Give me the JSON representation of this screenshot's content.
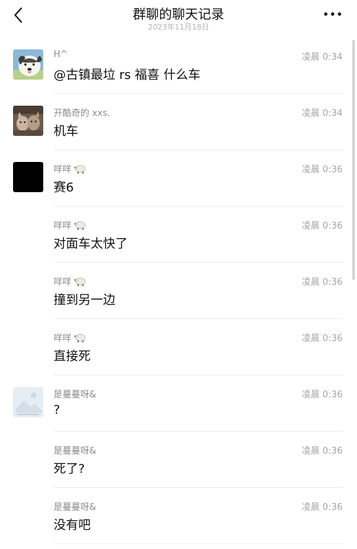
{
  "header": {
    "title": "群聊的聊天记录",
    "date": "2023年11月18日"
  },
  "messages": [
    {
      "sender": "H^",
      "time": "凌晨 0:34",
      "text": "@古镇最垃 rs 福喜 什么车",
      "avatar": "dog-photo-avatar"
    },
    {
      "sender": "开酷奇的 xxs.",
      "time": "凌晨 0:34",
      "text": "机车",
      "avatar": "cat-photo-avatar"
    },
    {
      "sender": "咩咩",
      "time": "凌晨 0:36",
      "text": "赛6",
      "avatar": "black-avatar",
      "emoji": "sheep-icon"
    },
    {
      "sender": "咩咩",
      "time": "凌晨 0:36",
      "text": "对面车太快了",
      "emoji": "sheep-icon"
    },
    {
      "sender": "咩咩",
      "time": "凌晨 0:36",
      "text": "撞到另一边",
      "emoji": "sheep-icon"
    },
    {
      "sender": "咩咩",
      "time": "凌晨 0:36",
      "text": "直接死",
      "emoji": "sheep-icon"
    },
    {
      "sender": "是蔓蔓呀&",
      "time": "凌晨 0:36",
      "text": "?",
      "avatar": "placeholder-image-avatar"
    },
    {
      "sender": "是蔓蔓呀&",
      "time": "凌晨 0:36",
      "text": "死了?"
    },
    {
      "sender": "是蔓蔓呀&",
      "time": "凌晨 0:36",
      "text": "没有吧"
    }
  ],
  "colors": {
    "background": "#ffffff",
    "sender_text": "#8c8c8c",
    "time_text": "#a6a6a6",
    "message_text": "#111111",
    "divider": "#ececec"
  }
}
